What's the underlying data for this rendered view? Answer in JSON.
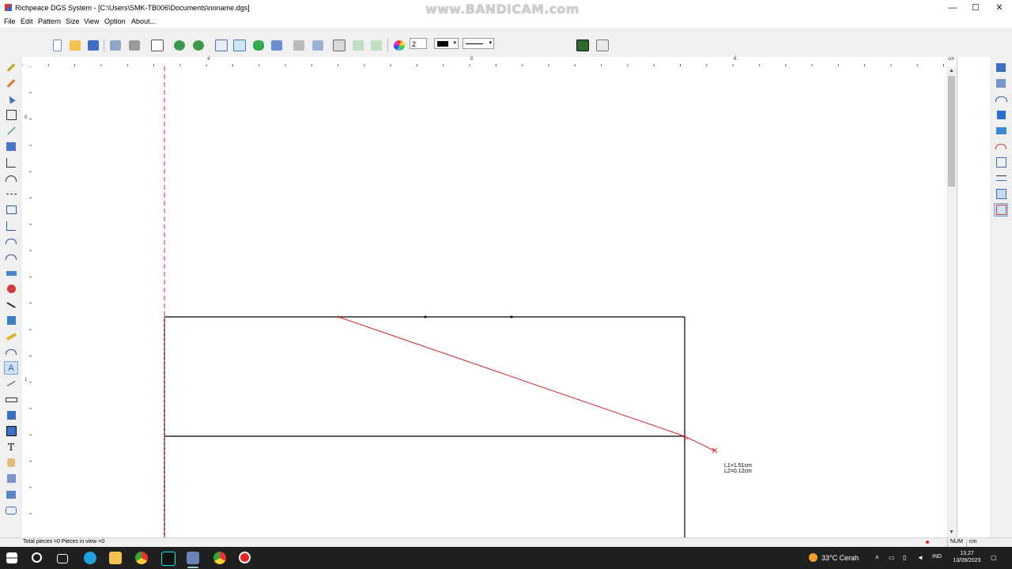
{
  "window": {
    "title": "Richpeace DGS System - [C:\\Users\\SMK-TB006\\Documents\\noname.dgs]",
    "minimize": "—",
    "maximize": "☐",
    "close": "✕"
  },
  "watermark": "www.BANDICAM.com",
  "menu": [
    "File",
    "Edit",
    "Pattern",
    "Size",
    "View",
    "Option",
    "About..."
  ],
  "toolbar": {
    "pen_width": "2",
    "colors": {
      "accent": "#d4282f",
      "paper": "#ffffff"
    }
  },
  "ruler_top_labels": [
    "4",
    "5",
    "6",
    "cm"
  ],
  "ruler_left_labels": [
    "0",
    "1"
  ],
  "canvas": {
    "measure_l1": "L1=1.51cm",
    "measure_l2": "L2=0.12cm"
  },
  "status": {
    "text": "Total pieces =0   Pieces in view =0",
    "num": "NUM",
    "unit": "cm"
  },
  "taskbar": {
    "weather": "33°C  Cerah",
    "lang": "IND",
    "time": "13.27",
    "date": "13/09/2023"
  }
}
